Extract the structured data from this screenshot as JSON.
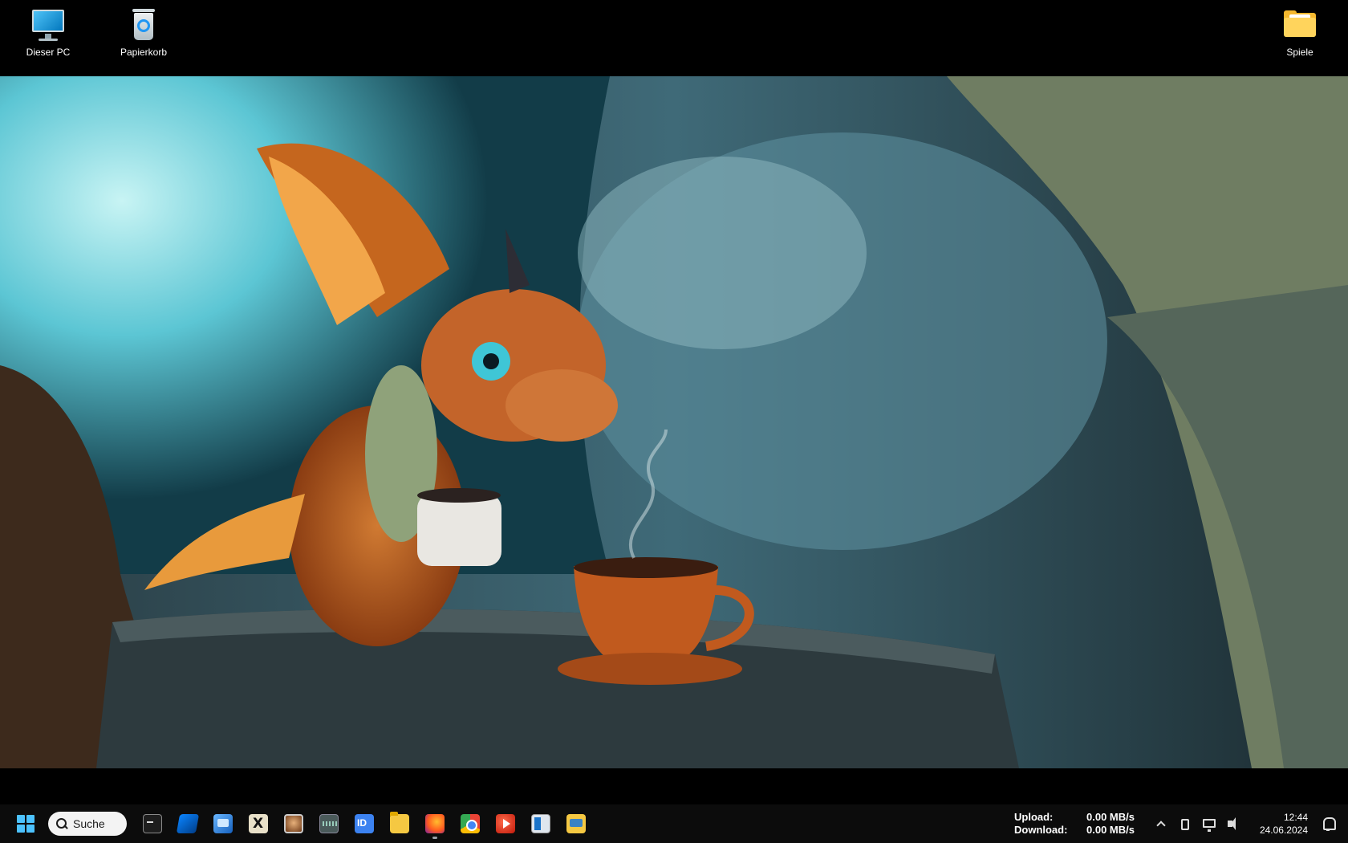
{
  "desktop": {
    "icons": [
      {
        "label": "Dieser PC",
        "icon": "computer-icon"
      },
      {
        "label": "Papierkorb",
        "icon": "recycle-bin-icon"
      },
      {
        "label": "Spiele",
        "icon": "folder-icon"
      }
    ],
    "wallpaper": "dragon-with-coffee-in-cave"
  },
  "taskbar": {
    "search_label": "Suche",
    "apps": [
      {
        "name": "terminal",
        "icon": "terminal-icon"
      },
      {
        "name": "app",
        "icon": "blue-app-icon"
      },
      {
        "name": "control-panel",
        "icon": "control-panel-icon"
      },
      {
        "name": "xd-app",
        "icon": "x-app-icon"
      },
      {
        "name": "app-round",
        "icon": "round-app-icon"
      },
      {
        "name": "chip-app",
        "icon": "chip-icon"
      },
      {
        "name": "id-app",
        "icon": "id-icon"
      },
      {
        "name": "file-explorer",
        "icon": "folder-icon"
      },
      {
        "name": "firefox",
        "icon": "firefox-icon",
        "active": true
      },
      {
        "name": "chrome",
        "icon": "chrome-icon"
      },
      {
        "name": "media-player",
        "icon": "play-icon"
      },
      {
        "name": "window-app",
        "icon": "window-icon"
      },
      {
        "name": "explorer-2",
        "icon": "folder-blue-icon"
      }
    ],
    "network": {
      "upload_label": "Upload:",
      "upload_value": "0.00 MB/s",
      "download_label": "Download:",
      "download_value": "0.00 MB/s"
    },
    "clock": {
      "time": "12:44",
      "date": "24.06.2024"
    }
  }
}
